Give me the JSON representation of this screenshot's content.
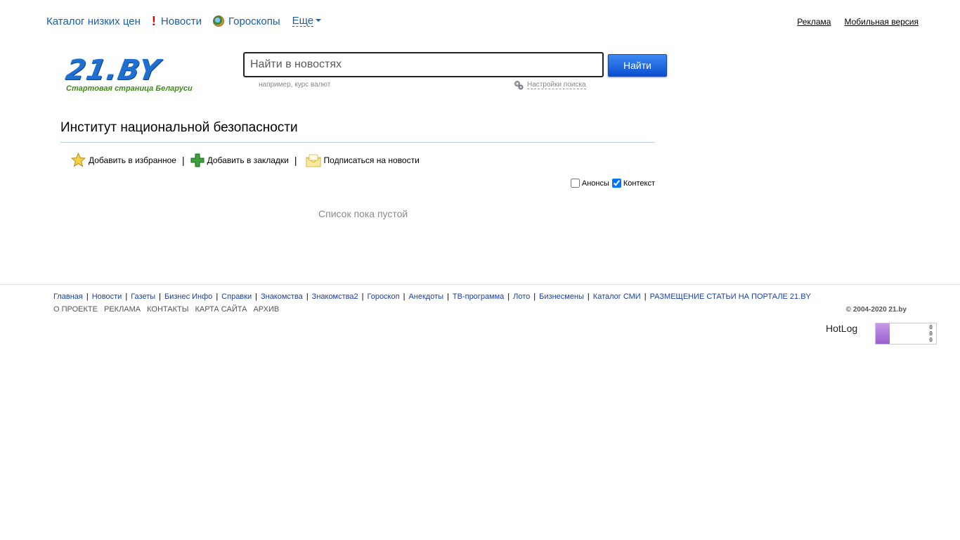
{
  "topnav": {
    "catalog": "Каталог низких цен",
    "news": "Новости",
    "horoscopes": "Гороскопы",
    "more": "Еще"
  },
  "toplinks": {
    "ads": "Реклама",
    "mobile": "Мобильная версия"
  },
  "logo": {
    "mark": "21.BY",
    "tagline": "Стартовая страница Беларуси"
  },
  "search": {
    "placeholder": "Найти в новостях",
    "button": "Найти",
    "hint": "например, курс валют",
    "settings": "Настройки поиска"
  },
  "page": {
    "title": "Институт национальной безопасности",
    "empty_message": "Список пока пустой"
  },
  "actions": {
    "favorites": "Добавить в избранное",
    "bookmarks": "Добавить в закладки",
    "subscribe": "Подписаться на новости",
    "separator": "|"
  },
  "filters": {
    "announcements": {
      "label": "Анонсы",
      "checked": false
    },
    "context": {
      "label": "Контекст",
      "checked": true
    }
  },
  "footer": {
    "links": [
      "Главная",
      "Новости",
      "Газеты",
      "Бизнес Инфо",
      "Справки",
      "Знакомства",
      "Знакомства2",
      "Гороскоп",
      "Анекдоты",
      "ТВ-программа",
      "Лото",
      "Бизнесмены",
      "Каталог СМИ",
      "РАЗМЕЩЕНИЕ СТАТЬИ НА ПОРТАЛЕ 21.BY"
    ],
    "secondary": [
      "О ПРОЕКТЕ",
      "РЕКЛАМА",
      "КОНТАКТЫ",
      "КАРТА САЙТА",
      "АРХИВ"
    ],
    "copyright": "© 2004-2020 21.by",
    "hotlog_alt": "HotLog",
    "counter_values": [
      "0",
      "0",
      "0"
    ]
  },
  "colors": {
    "link": "#1a5fa8",
    "accent_button": "#0b4fd0",
    "tagline": "#3f8a1f"
  }
}
